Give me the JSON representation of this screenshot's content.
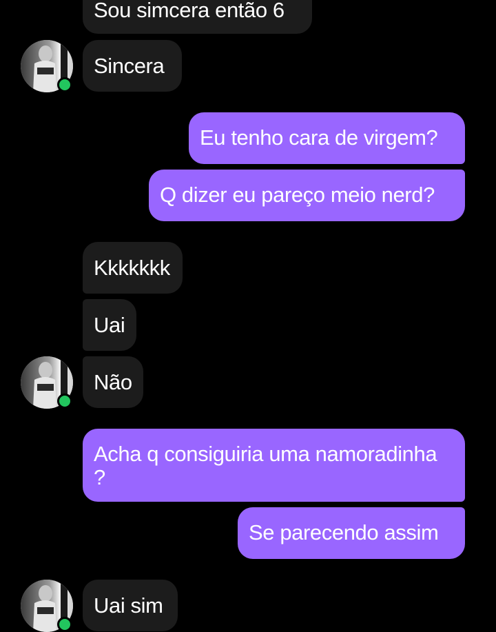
{
  "colors": {
    "background": "#000000",
    "received_bubble": "#1c1c1c",
    "sent_bubble": "#9966ff",
    "online_indicator": "#22c55e"
  },
  "messages": [
    {
      "direction": "received",
      "text": "Sou simcera então 6"
    },
    {
      "direction": "received",
      "text": "Sincera"
    },
    {
      "direction": "sent",
      "text": "Eu tenho cara de virgem?"
    },
    {
      "direction": "sent",
      "text": "Q dizer eu pareço meio nerd?"
    },
    {
      "direction": "received",
      "text": "Kkkkkkk"
    },
    {
      "direction": "received",
      "text": "Uai"
    },
    {
      "direction": "received",
      "text": "Não"
    },
    {
      "direction": "sent",
      "text": "Acha q consiguiria uma namoradinha ?"
    },
    {
      "direction": "sent",
      "text": "Se parecendo assim"
    },
    {
      "direction": "received",
      "text": "Uai sim"
    }
  ],
  "avatar": {
    "icon": "contact-avatar",
    "status": "online"
  }
}
